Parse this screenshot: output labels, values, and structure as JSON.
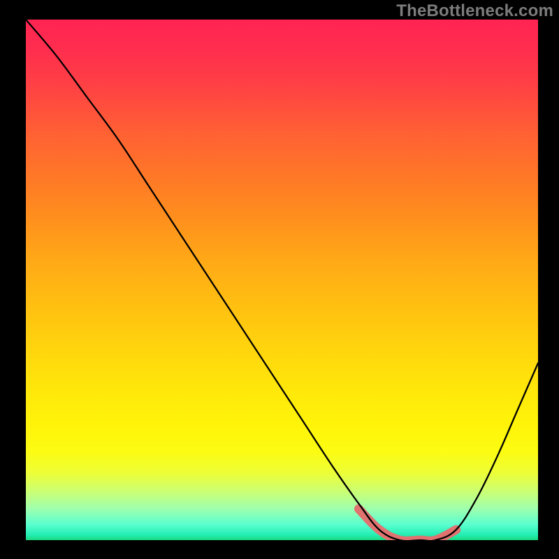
{
  "watermark": {
    "text": "TheBottleneck.com"
  },
  "colors": {
    "background": "#000000",
    "watermark_text": "#7c7c7c",
    "curve_black": "#000000",
    "curve_highlight": "#e07270",
    "gradient_top": "#ff2453",
    "gradient_bottom_green": "#1ad87b"
  },
  "chart_data": {
    "type": "line",
    "title": "",
    "xlabel": "",
    "ylabel": "",
    "xlim": [
      0,
      100
    ],
    "ylim": [
      0,
      100
    ],
    "series": [
      {
        "name": "bottleneck-curve",
        "x": [
          0,
          6,
          12,
          18,
          24,
          30,
          36,
          42,
          48,
          54,
          60,
          65,
          69,
          73,
          77,
          80,
          84,
          88,
          92,
          96,
          100
        ],
        "y": [
          100,
          93,
          85,
          77,
          68,
          59,
          50,
          41,
          32,
          23,
          14,
          7,
          2,
          0,
          0,
          0,
          2,
          8,
          16,
          25,
          34
        ]
      },
      {
        "name": "optimal-range-highlight",
        "x": [
          65,
          69,
          73,
          77,
          80,
          84
        ],
        "y": [
          6,
          2,
          0,
          0,
          0,
          2
        ]
      }
    ],
    "annotations": []
  }
}
